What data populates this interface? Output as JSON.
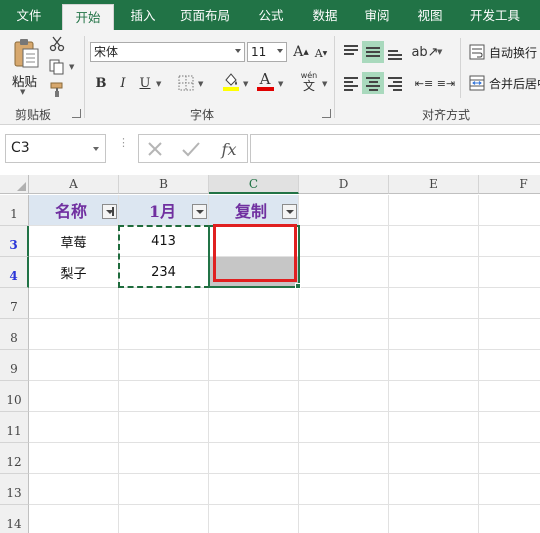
{
  "tabs": [
    {
      "label": "文件",
      "active": false
    },
    {
      "label": "开始",
      "active": true
    },
    {
      "label": "插入",
      "active": false
    },
    {
      "label": "页面布局",
      "active": false
    },
    {
      "label": "公式",
      "active": false
    },
    {
      "label": "数据",
      "active": false
    },
    {
      "label": "审阅",
      "active": false
    },
    {
      "label": "视图",
      "active": false
    },
    {
      "label": "开发工具",
      "active": false
    }
  ],
  "ribbon": {
    "clipboard": {
      "label": "剪贴板",
      "paste_label": "粘贴"
    },
    "font": {
      "label": "字体",
      "font_name": "宋体",
      "font_size": "11",
      "bold": "B",
      "italic": "I",
      "underline": "U",
      "grow_font": "A",
      "shrink_font": "A",
      "font_color_glyph": "A",
      "phonetic_top": "wén",
      "phonetic_bottom": "文"
    },
    "alignment": {
      "label": "对齐方式",
      "wrap_text": "自动换行",
      "merge_center": "合并后居中"
    }
  },
  "formula_bar": {
    "name_box": "C3",
    "fx": "fx",
    "formula": ""
  },
  "grid": {
    "columns": [
      "A",
      "B",
      "C",
      "D",
      "E",
      "F"
    ],
    "selected_column": "C",
    "rows": [
      {
        "label": "1",
        "filtered": false
      },
      {
        "label": "3",
        "filtered": true
      },
      {
        "label": "4",
        "filtered": true
      },
      {
        "label": "7",
        "filtered": false
      },
      {
        "label": "8",
        "filtered": false
      },
      {
        "label": "9",
        "filtered": false
      },
      {
        "label": "10",
        "filtered": false
      },
      {
        "label": "11",
        "filtered": false
      },
      {
        "label": "12",
        "filtered": false
      },
      {
        "label": "13",
        "filtered": false
      },
      {
        "label": "14",
        "filtered": false
      }
    ],
    "headers": [
      "名称",
      "1月",
      "复制"
    ],
    "data": [
      {
        "name": "草莓",
        "jan": "413",
        "copy": ""
      },
      {
        "name": "梨子",
        "jan": "234",
        "copy": ""
      }
    ]
  },
  "colors": {
    "excel_green": "#217346",
    "header_fill": "#dce6f1",
    "header_text": "#7030a0",
    "highlight_red": "#e02020",
    "font_color_bar": "#e00000",
    "fill_color_bar": "#ffff00"
  }
}
